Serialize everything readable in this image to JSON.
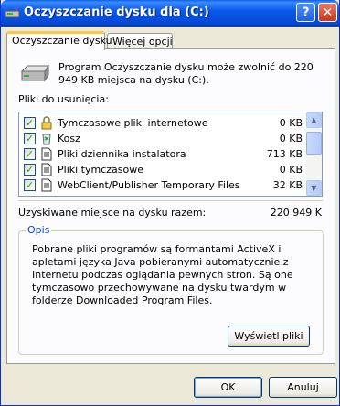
{
  "window": {
    "title": "Oczyszczanie dysku dla  (C:)",
    "help_label": "?",
    "close_label": "✕"
  },
  "tabs": [
    {
      "label": "Oczyszczanie dysku",
      "active": true
    },
    {
      "label": "Więcej opcji",
      "active": false
    }
  ],
  "intro": "Program Oczyszczanie dysku może zwolnić do 220 949 KB miejsca na dysku  (C:).",
  "list": {
    "label": "Pliki do usunięcia:",
    "items": [
      {
        "name": "Tymczasowe pliki internetowe",
        "size": "0 KB",
        "checked": true,
        "icon": "lock-icon"
      },
      {
        "name": "Kosz",
        "size": "0 KB",
        "checked": true,
        "icon": "recycle-bin-icon"
      },
      {
        "name": "Pliki dziennika instalatora",
        "size": "713 KB",
        "checked": true,
        "icon": "document-icon"
      },
      {
        "name": "Pliki tymczasowe",
        "size": "0 KB",
        "checked": true,
        "icon": "document-icon"
      },
      {
        "name": "WebClient/Publisher Temporary Files",
        "size": "32 KB",
        "checked": true,
        "icon": "document-icon"
      }
    ]
  },
  "total": {
    "label": "Uzyskiwane miejsce na dysku razem:",
    "value": "220 949 K"
  },
  "description": {
    "legend": "Opis",
    "text": "Pobrane pliki programów są formantami ActiveX i apletami języka Java pobieranymi automatycznie z Internetu podczas oglądania pewnych stron. Są one tymczasowo przechowywane na dysku twardym w folderze Downloaded Program Files."
  },
  "buttons": {
    "view_files": "Wyświetl pliki",
    "ok": "OK",
    "cancel": "Anuluj"
  },
  "colors": {
    "titlebar": "#0449D6",
    "face": "#ECE9D8",
    "tab_highlight": "#FFC83C",
    "group_legend": "#0046D5"
  }
}
